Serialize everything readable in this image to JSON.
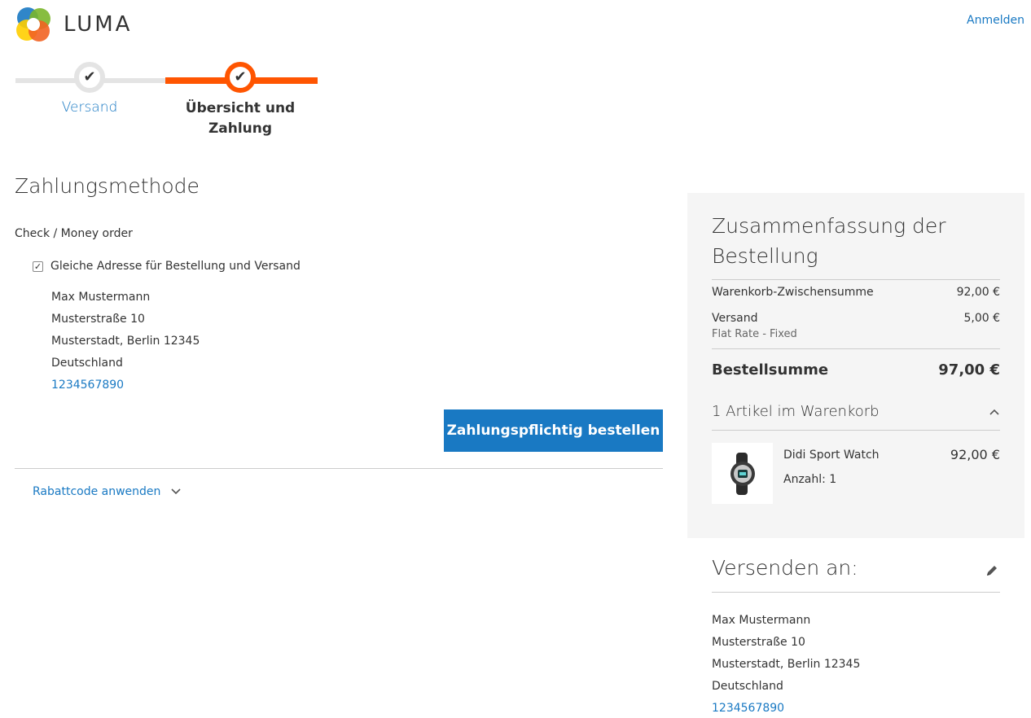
{
  "header": {
    "brand": "LUMA",
    "signin_label": "Anmelden",
    "logo_colors": [
      "#f26322",
      "#1979c3",
      "#7ab62b",
      "#ffce00"
    ]
  },
  "progress": {
    "steps": [
      {
        "label": "Versand",
        "state": "complete"
      },
      {
        "label": "Übersicht und Zahlung",
        "state": "active"
      }
    ],
    "accent_color": "#ff5501"
  },
  "payment": {
    "title": "Zahlungsmethode",
    "method": "Check / Money order",
    "same_address_label": "Gleiche Adresse für Bestellung und Versand",
    "same_address_checked": true,
    "address": {
      "name": "Max Mustermann",
      "street": "Musterstraße 10",
      "city_line": "Musterstadt, Berlin 12345",
      "country": "Deutschland",
      "phone": "1234567890"
    },
    "place_order_label": "Zahlungspflichtig bestellen",
    "discount_label": "Rabattcode anwenden"
  },
  "summary": {
    "title": "Zusammenfassung der Bestellung",
    "subtotal_label": "Warenkorb-Zwischensumme",
    "subtotal_value": "92,00 €",
    "shipping_label": "Versand",
    "shipping_value": "5,00 €",
    "shipping_method": "Flat Rate - Fixed",
    "total_label": "Bestellsumme",
    "total_value": "97,00 €",
    "items_heading": "1 Artikel im Warenkorb",
    "items": [
      {
        "name": "Didi Sport Watch",
        "qty_label": "Anzahl: 1",
        "price": "92,00 €"
      }
    ]
  },
  "ship_to": {
    "title": "Versenden an:",
    "address": {
      "name": "Max Mustermann",
      "street": "Musterstraße 10",
      "city_line": "Musterstadt, Berlin 12345",
      "country": "Deutschland",
      "phone": "1234567890"
    }
  },
  "colors": {
    "link": "#1979c3",
    "button": "#1979c3",
    "summary_bg": "#f5f5f5"
  }
}
